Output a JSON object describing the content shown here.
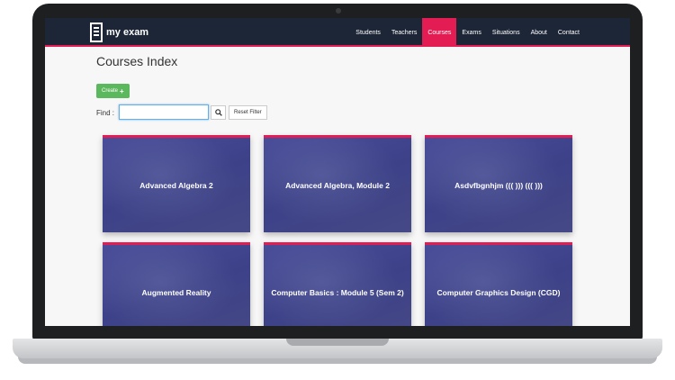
{
  "navbar": {
    "brand": "my exam",
    "items": [
      {
        "label": "Students",
        "active": false
      },
      {
        "label": "Teachers",
        "active": false
      },
      {
        "label": "Courses",
        "active": true
      },
      {
        "label": "Exams",
        "active": false
      },
      {
        "label": "Situations",
        "active": false
      },
      {
        "label": "About",
        "active": false
      },
      {
        "label": "Contact",
        "active": false
      }
    ]
  },
  "page": {
    "title": "Courses Index",
    "create_label": "Create",
    "create_icon": "plus-icon",
    "find_label": "Find :",
    "find_value": "",
    "search_icon": "search-icon",
    "reset_label": "Reset Filter"
  },
  "courses": [
    {
      "title": "Advanced Algebra 2"
    },
    {
      "title": "Advanced Algebra, Module 2"
    },
    {
      "title": "Asdvfbgnhjm ((( ))) ((( )))"
    },
    {
      "title": "Augmented Reality"
    },
    {
      "title": "Computer Basics : Module 5 (Sem 2)"
    },
    {
      "title": "Computer Graphics Design (CGD)"
    }
  ],
  "colors": {
    "navbar": "#1c2637",
    "accent": "#e31c54",
    "create": "#5cb85c",
    "card": "#3d4188"
  }
}
